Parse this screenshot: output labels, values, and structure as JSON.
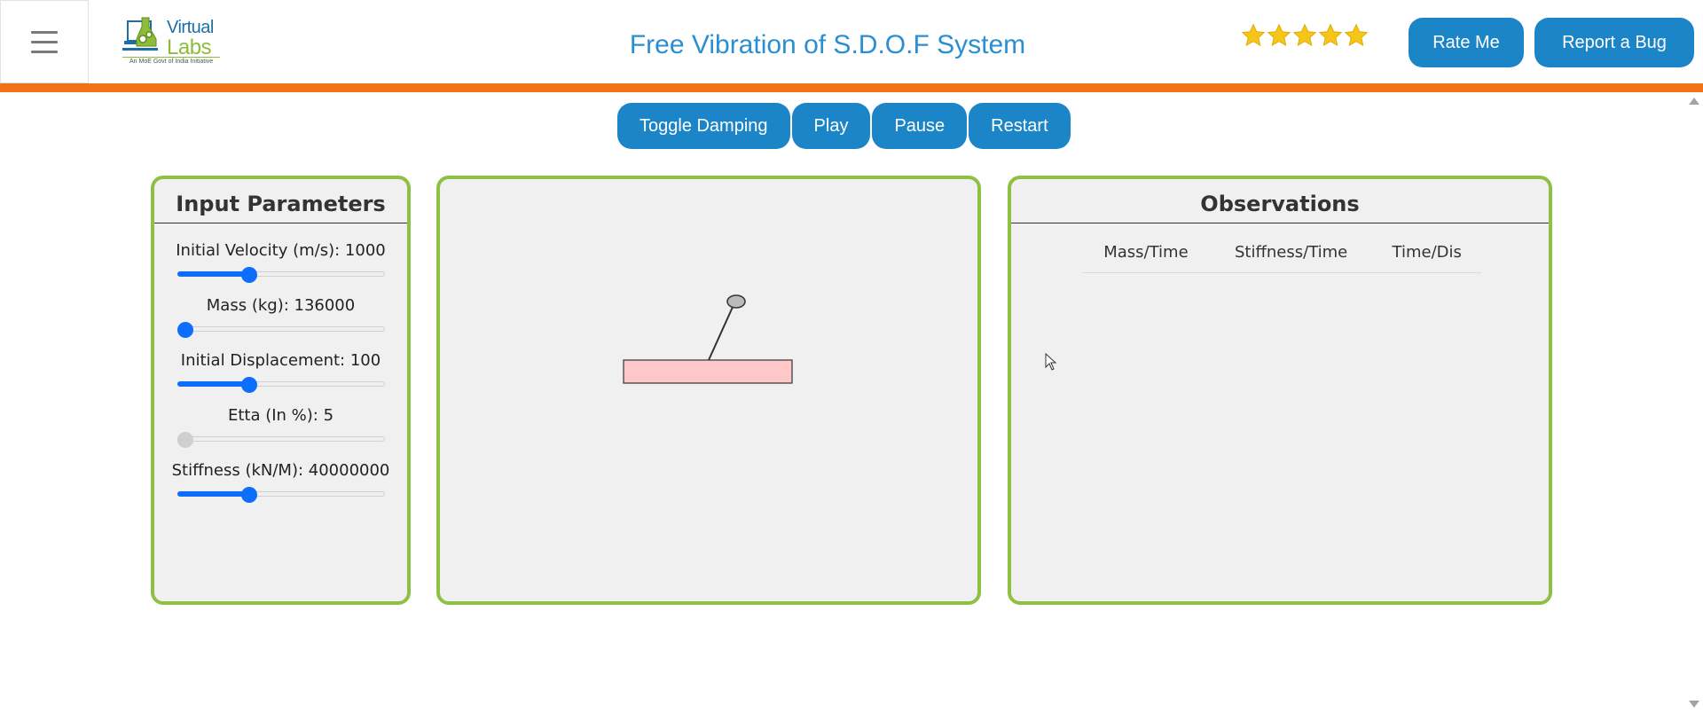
{
  "header": {
    "logo": {
      "word1": "Virtual",
      "word2": "Labs",
      "tagline": "An MoE Govt of India Initiative"
    },
    "title": "Free Vibration of S.D.O.F System",
    "rating": {
      "stars": 5,
      "max": 5,
      "color": "#f5c518"
    },
    "rate_label": "Rate Me",
    "bug_label": "Report a Bug"
  },
  "colors": {
    "accent": "#1c85c8",
    "orange": "#ef7217",
    "panel_border": "#8dc043",
    "slider": "#0d6efd",
    "mass": "#ffc8c8"
  },
  "controls": {
    "toggle_damping": "Toggle Damping",
    "play": "Play",
    "pause": "Pause",
    "restart": "Restart"
  },
  "inputs": {
    "title": "Input Parameters",
    "params": [
      {
        "label": "Initial Velocity (m/s): 1000",
        "level": 0.35,
        "enabled": true
      },
      {
        "label": "Mass (kg): 136000",
        "level": 0.0,
        "enabled": true
      },
      {
        "label": "Initial Displacement: 100",
        "level": 0.35,
        "enabled": true
      },
      {
        "label": "Etta (In %): 5",
        "level": 0.0,
        "enabled": false
      },
      {
        "label": "Stiffness (kN/M): 40000000",
        "level": 0.35,
        "enabled": true
      }
    ]
  },
  "observations": {
    "title": "Observations",
    "columns": [
      "Mass/Time",
      "Stiffness/Time",
      "Time/Dis"
    ]
  }
}
